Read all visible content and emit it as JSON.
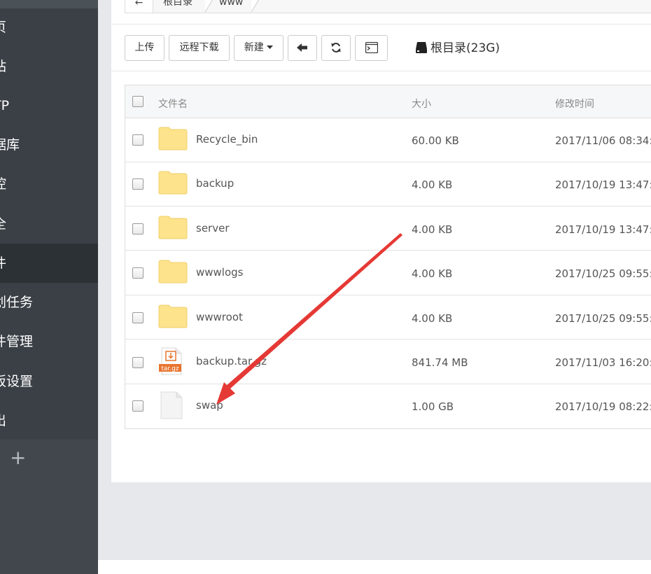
{
  "sidebar": {
    "items": [
      {
        "label": "页"
      },
      {
        "label": "站"
      },
      {
        "label": "TP"
      },
      {
        "label": "据库"
      },
      {
        "label": "控"
      },
      {
        "label": "全"
      },
      {
        "label": "件"
      },
      {
        "label": "划任务"
      },
      {
        "label": "件管理"
      },
      {
        "label": "板设置"
      },
      {
        "label": "出"
      }
    ],
    "add_label": "+"
  },
  "breadcrumb": {
    "back": "←",
    "crumbs": [
      "根目录",
      "www"
    ]
  },
  "toolbar": {
    "upload": "上传",
    "remote_download": "远程下载",
    "new": "新建",
    "disk_label": "根目录(23G)"
  },
  "table": {
    "headers": {
      "name": "文件名",
      "size": "大小",
      "mtime": "修改时间"
    },
    "rows": [
      {
        "name": "Recycle_bin",
        "size": "60.00 KB",
        "mtime": "2017/11/06 08:34:1",
        "type": "folder"
      },
      {
        "name": "backup",
        "size": "4.00 KB",
        "mtime": "2017/10/19 13:47:0",
        "type": "folder"
      },
      {
        "name": "server",
        "size": "4.00 KB",
        "mtime": "2017/10/19 13:47:5",
        "type": "folder"
      },
      {
        "name": "wwwlogs",
        "size": "4.00 KB",
        "mtime": "2017/10/25 09:55:2",
        "type": "folder"
      },
      {
        "name": "wwwroot",
        "size": "4.00 KB",
        "mtime": "2017/10/25 09:55:2",
        "type": "folder"
      },
      {
        "name": "backup.tar.gz",
        "size": "841.74 MB",
        "mtime": "2017/11/03 16:20:0",
        "type": "archive",
        "badge": "tar.gz"
      },
      {
        "name": "swap",
        "size": "1.00 GB",
        "mtime": "2017/10/19 08:22:0",
        "type": "file"
      }
    ]
  },
  "colors": {
    "sidebar_bg": "#3a4046",
    "sidebar_active": "#2c3136",
    "folder": "#fde38c",
    "archive": "#e8742f",
    "arrow": "#e53935"
  }
}
